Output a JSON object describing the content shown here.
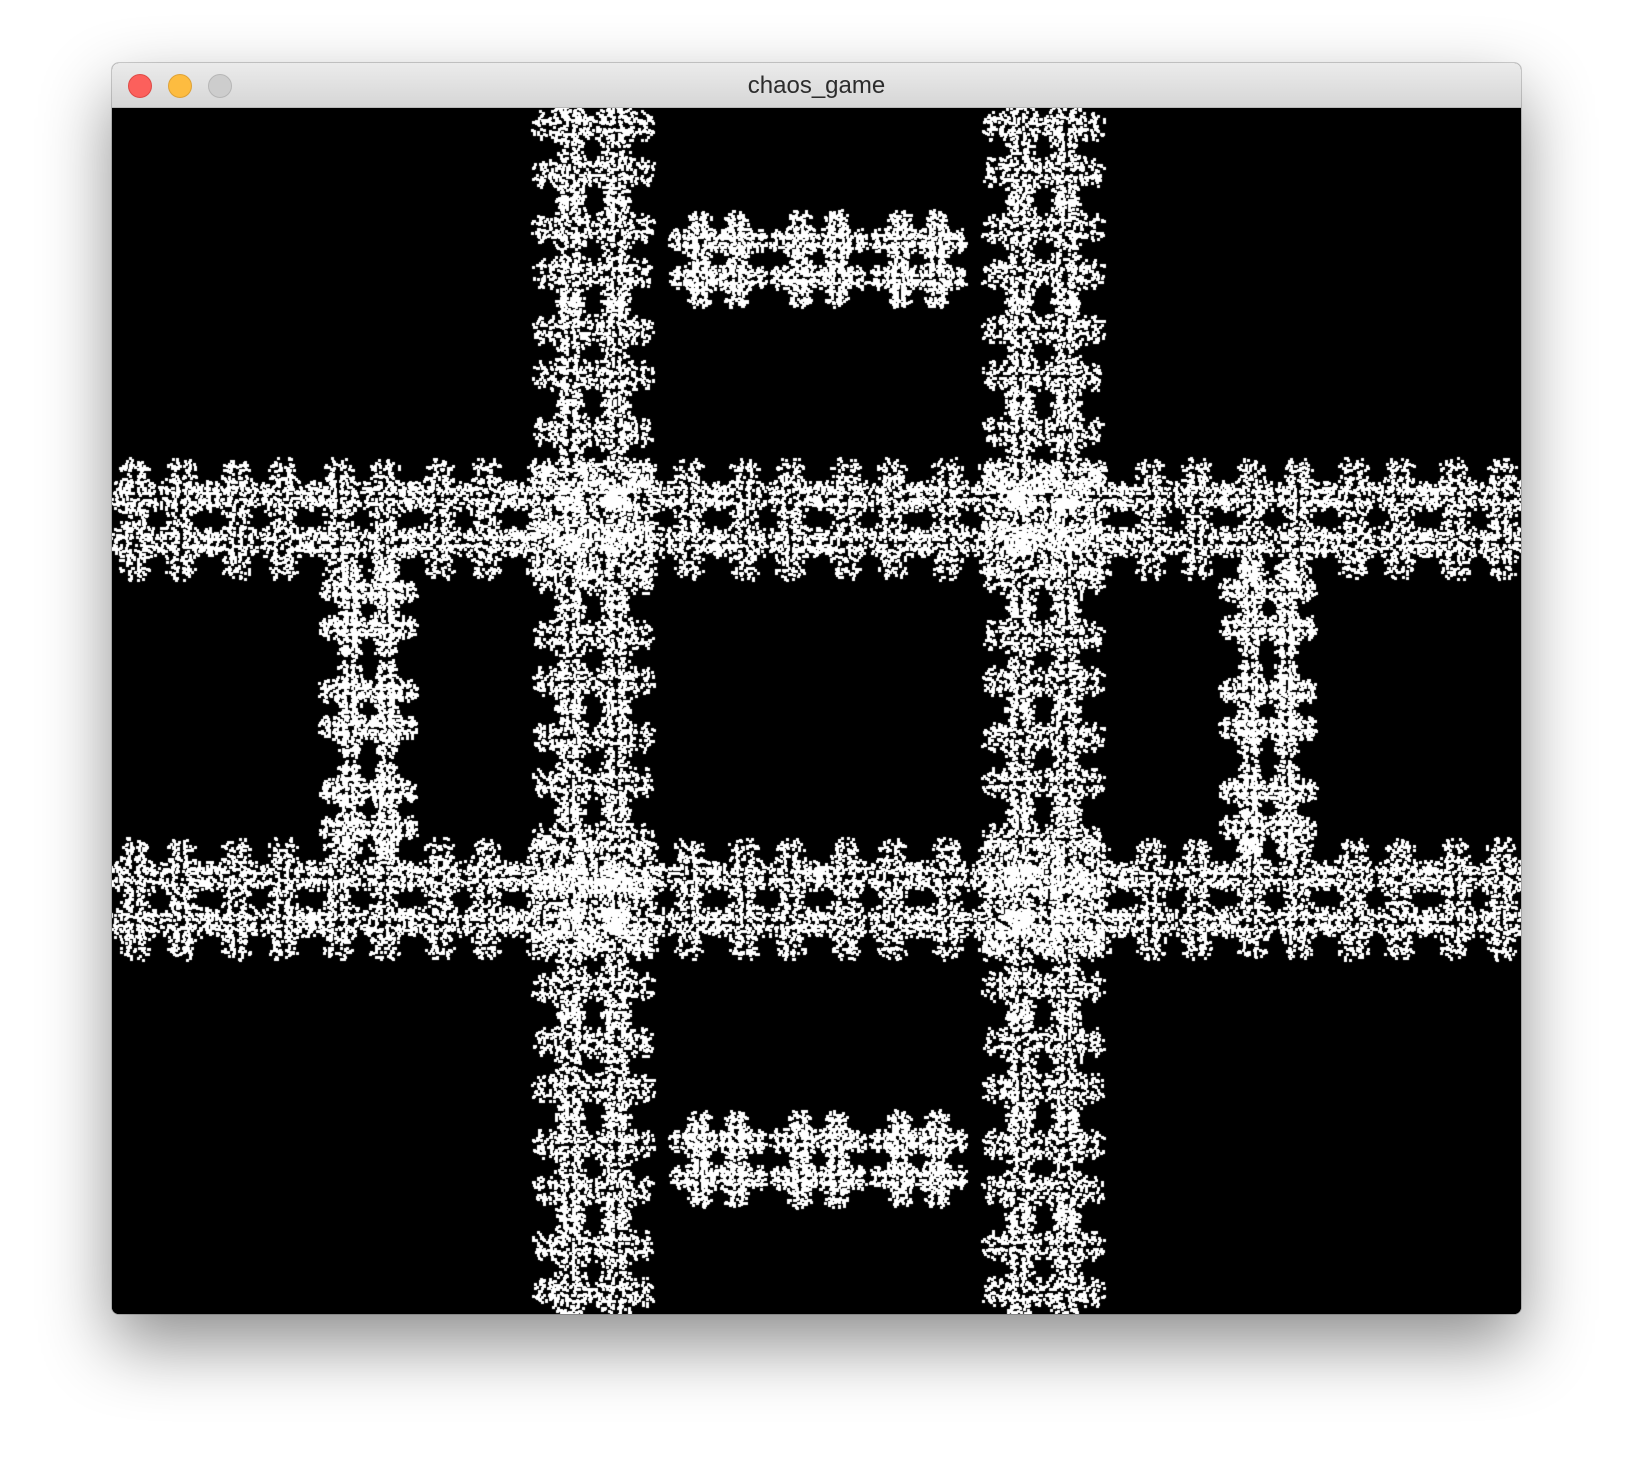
{
  "window": {
    "title": "chaos_game",
    "buttons": {
      "close": "close-button",
      "minimize": "minimize-button",
      "zoom": "zoom-button"
    }
  },
  "colors": {
    "background": "#000000",
    "points": "#ffffff",
    "close": "#fc605c",
    "minimize": "#fdbc40",
    "zoom_disabled": "#cdcdcd"
  }
}
